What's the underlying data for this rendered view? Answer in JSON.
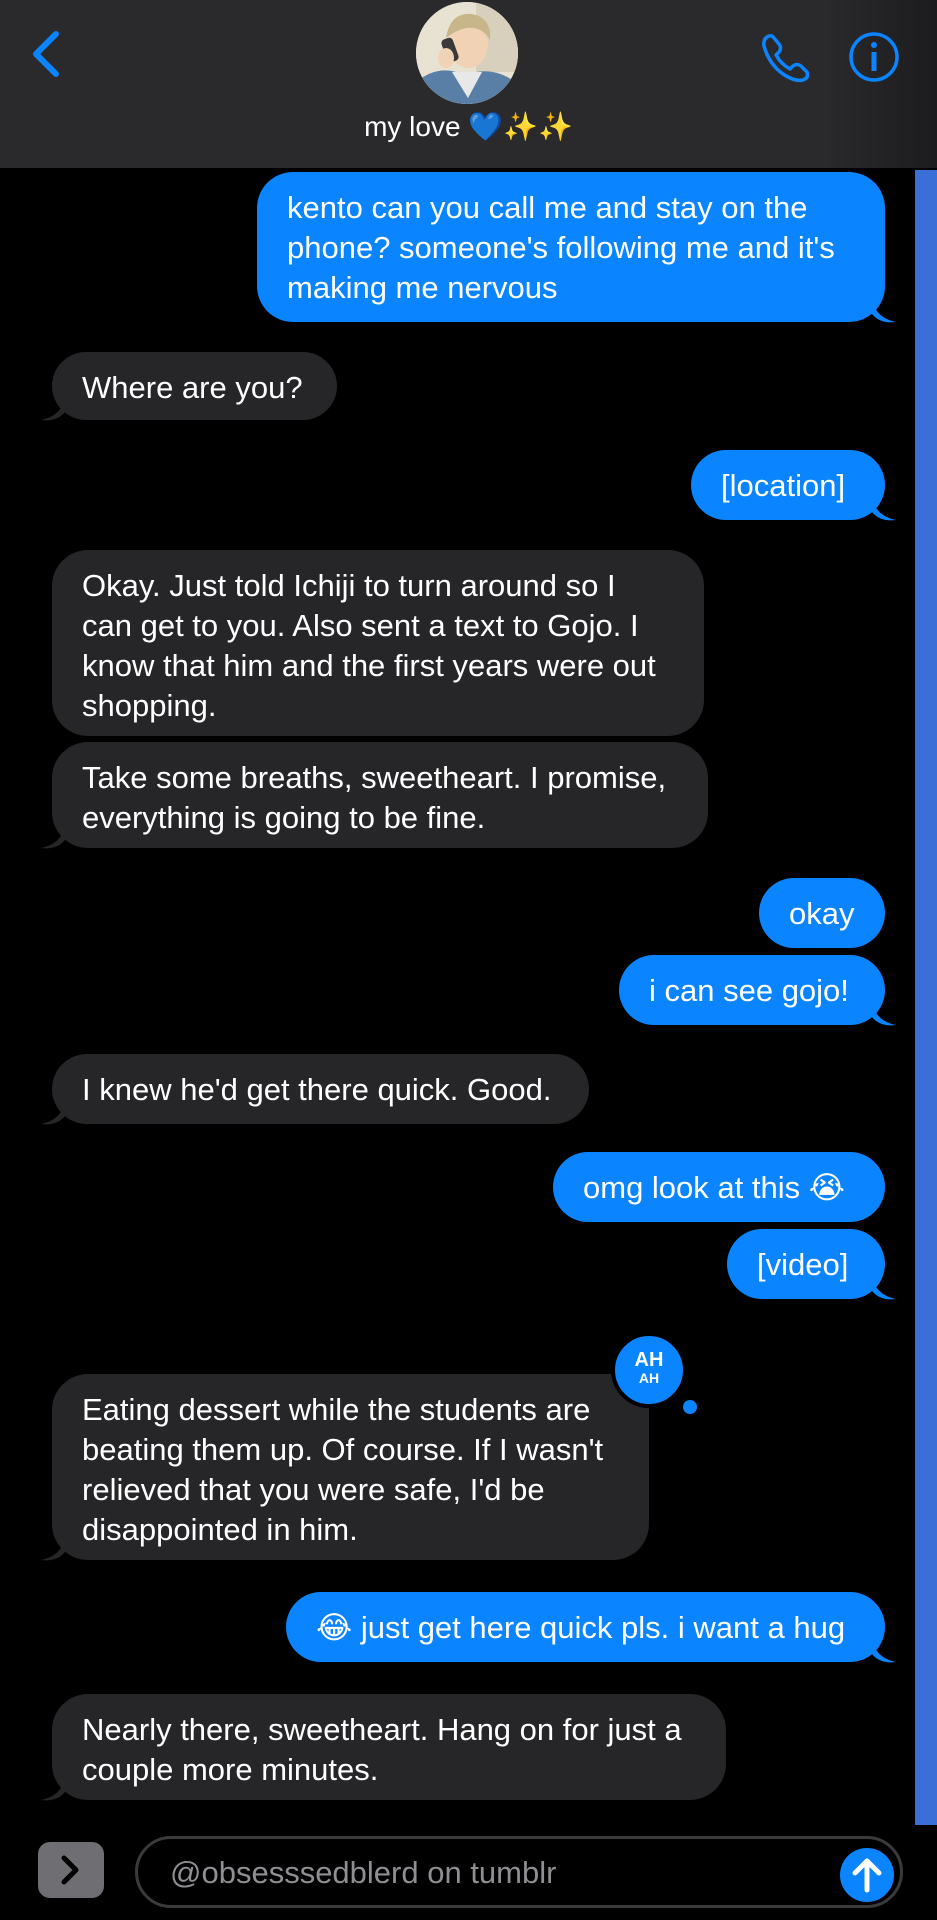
{
  "header": {
    "contact_name": "my love 💙✨✨",
    "back_icon": "chevron-left-icon",
    "call_icon": "phone-icon",
    "info_icon": "info-icon",
    "accent_color": "#0a84ff"
  },
  "messages": [
    {
      "from": "me",
      "text": "kento can you call me and stay on the phone? someone's following me and it's making me nervous"
    },
    {
      "from": "them",
      "text": "Where are you?"
    },
    {
      "from": "me",
      "text": "[location]"
    },
    {
      "from": "them",
      "text": "Okay. Just told Ichiji to turn around so I can get to you. Also sent a text to Gojo. I know that him and the first years were out shopping."
    },
    {
      "from": "them",
      "text": "Take some breaths, sweetheart. I promise, everything is going to be fine."
    },
    {
      "from": "me",
      "text": "okay"
    },
    {
      "from": "me",
      "text": "i can see gojo!"
    },
    {
      "from": "them",
      "text": "I knew he'd get there quick. Good."
    },
    {
      "from": "me",
      "text": "omg look at this 😭"
    },
    {
      "from": "me",
      "text": "[video]"
    },
    {
      "from": "them",
      "text": "Eating dessert while the students are beating them up. Of course. If I wasn't relieved that you were safe, I'd be disappointed in him."
    },
    {
      "from": "me",
      "text": "😂 just get here quick pls. i want a hug"
    },
    {
      "from": "them",
      "text": "Nearly there, sweetheart. Hang on for just a couple more minutes."
    }
  ],
  "tapback": {
    "line1": "AH",
    "line2": "AH"
  },
  "compose": {
    "placeholder": "@obsesssedblerd on tumblr",
    "apps_icon": "chevron-right-icon",
    "send_icon": "arrow-up-icon"
  }
}
